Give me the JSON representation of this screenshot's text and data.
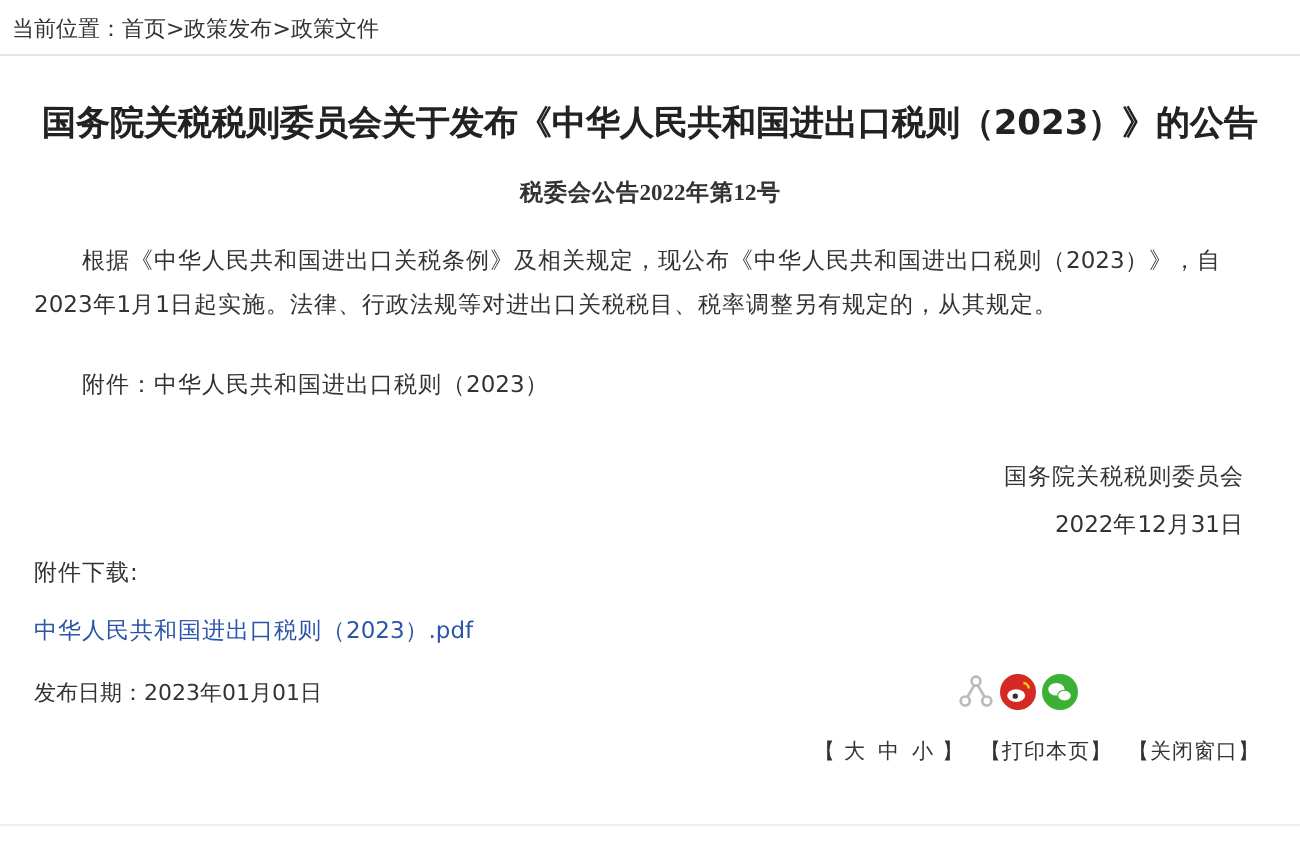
{
  "breadcrumb": {
    "label": "当前位置：",
    "items": [
      "首页",
      "政策发布",
      "政策文件"
    ],
    "separator": ">"
  },
  "article": {
    "title": "国务院关税税则委员会关于发布《中华人民共和国进出口税则（2023）》的公告",
    "doc_number": "税委会公告2022年第12号",
    "paragraphs": [
      "根据《中华人民共和国进出口关税条例》及相关规定，现公布《中华人民共和国进出口税则（2023）》，自2023年1月1日起实施。法律、行政法规等对进出口关税税目、税率调整另有规定的，从其规定。",
      "附件：中华人民共和国进出口税则（2023）"
    ],
    "signature": "国务院关税税则委员会",
    "signed_date": "2022年12月31日"
  },
  "attachments": {
    "label": "附件下载:",
    "files": [
      "中华人民共和国进出口税则（2023）.pdf"
    ]
  },
  "publish_date": "发布日期：2023年01月01日",
  "share_icons": [
    {
      "kind": "share"
    },
    {
      "kind": "weibo",
      "color": "#d52a23"
    },
    {
      "kind": "wechat",
      "color": "#3cb034"
    }
  ],
  "tools": {
    "font_size": {
      "open": "【",
      "sizes": [
        "大",
        "中",
        "小"
      ],
      "close": "】"
    },
    "links": [
      "【打印本页】",
      "【关闭窗口】"
    ]
  }
}
